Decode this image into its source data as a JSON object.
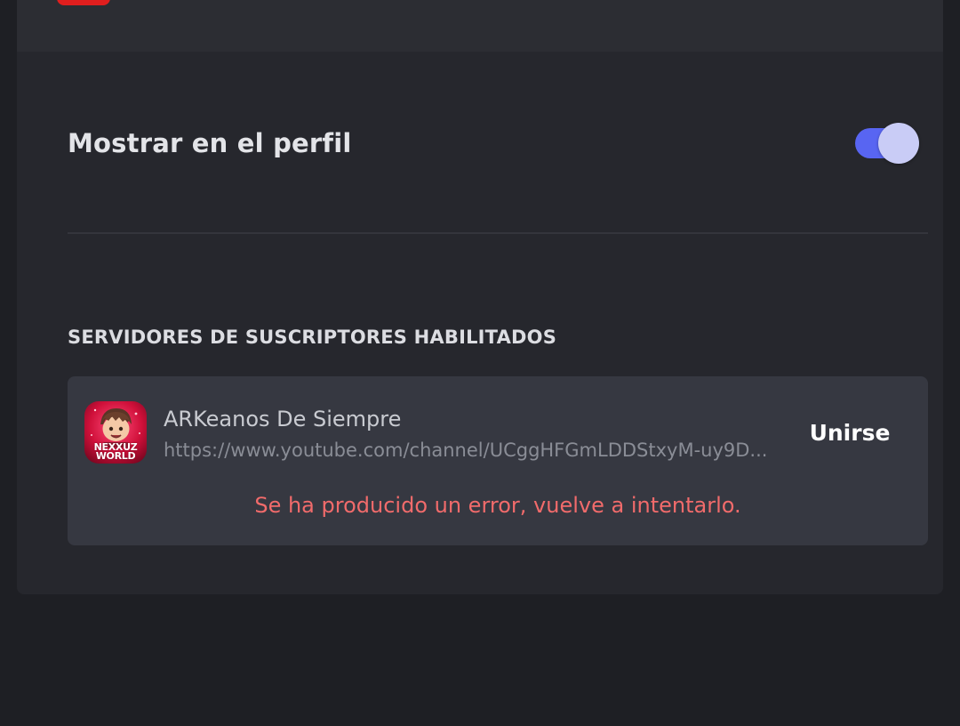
{
  "toggle_row": {
    "label": "Mostrar en el perfil",
    "enabled": true,
    "accent_color": "#5865f2"
  },
  "section": {
    "title": "SERVIDORES DE SUSCRIPTORES HABILITADOS"
  },
  "server": {
    "name": "ARKeanos De Siempre",
    "url": "https://www.youtube.com/channel/UCggHFGmLDDStxyM-uy9D...",
    "join_label": "Unirse",
    "avatar_text_line1": "NEXXUZ",
    "avatar_text_line2": "WORLD",
    "error_message": "Se ha producido un error, vuelve a intentarlo.",
    "error_color": "#f16b6b"
  },
  "colors": {
    "background": "#1e1f24",
    "card": "#26272d",
    "server_card": "#363841",
    "youtube_red": "#e01e1e"
  }
}
